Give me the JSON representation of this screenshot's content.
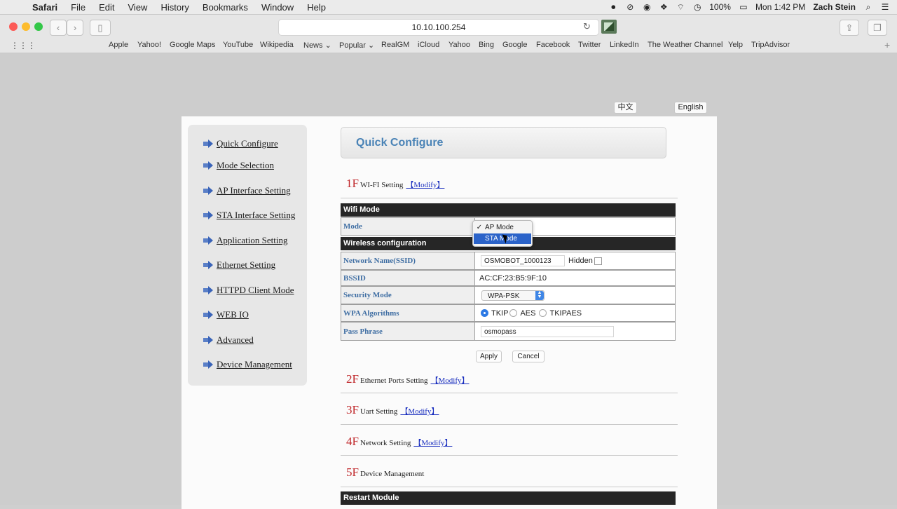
{
  "menubar": {
    "app": "Safari",
    "items": [
      "File",
      "Edit",
      "View",
      "History",
      "Bookmarks",
      "Window",
      "Help"
    ],
    "battery": "100%",
    "clock": "Mon 1:42 PM",
    "user": "Zach Stein"
  },
  "browser": {
    "url": "10.10.100.254",
    "bookmarks": [
      "Apple",
      "Yahoo!",
      "Google Maps",
      "YouTube",
      "Wikipedia",
      "News",
      "Popular",
      "RealGM",
      "iCloud",
      "Yahoo",
      "Bing",
      "Google",
      "Facebook",
      "Twitter",
      "LinkedIn",
      "The Weather Channel",
      "Yelp",
      "TripAdvisor"
    ]
  },
  "lang": {
    "chinese": "中文",
    "english": "English"
  },
  "sidebar": {
    "items": [
      "Quick Configure",
      "Mode Selection",
      "AP Interface Setting",
      "STA Interface Setting",
      "Application Setting",
      "Ethernet Setting",
      "HTTPD Client Mode",
      "WEB IO",
      "Advanced",
      "Device Management"
    ]
  },
  "main": {
    "title": "Quick Configure",
    "modify_label": "【Modify】",
    "sections": [
      {
        "num": "1F",
        "label": "WI-FI Setting"
      },
      {
        "num": "2F",
        "label": "Ethernet Ports Setting"
      },
      {
        "num": "3F",
        "label": "Uart Setting"
      },
      {
        "num": "4F",
        "label": "Network Setting"
      },
      {
        "num": "5F",
        "label": "Device Management"
      }
    ],
    "wifi_mode_header": "Wifi Mode",
    "mode_label": "Mode",
    "mode_options": [
      "AP Mode",
      "STA Mode"
    ],
    "mode_selected": "STA Mode",
    "wireless_header": "Wireless configuration",
    "ssid_label": "Network Name(SSID)",
    "ssid_value": "OSMOBOT_1000123",
    "hidden_label": "Hidden",
    "bssid_label": "BSSID",
    "bssid_value": "AC:CF:23:B5:9F:10",
    "security_label": "Security Mode",
    "security_value": "WPA-PSK",
    "wpa_label": "WPA Algorithms",
    "wpa_options": [
      "TKIP",
      "AES",
      "TKIPAES"
    ],
    "wpa_selected": "TKIP",
    "pass_label": "Pass Phrase",
    "pass_value": "osmopass",
    "apply": "Apply",
    "cancel": "Cancel",
    "restart_header": "Restart Module"
  },
  "colors": {
    "accent": "#4a83b6",
    "section_number": "#c0282b",
    "link": "#1a2fbf",
    "select_highlight": "#2b63c9"
  }
}
